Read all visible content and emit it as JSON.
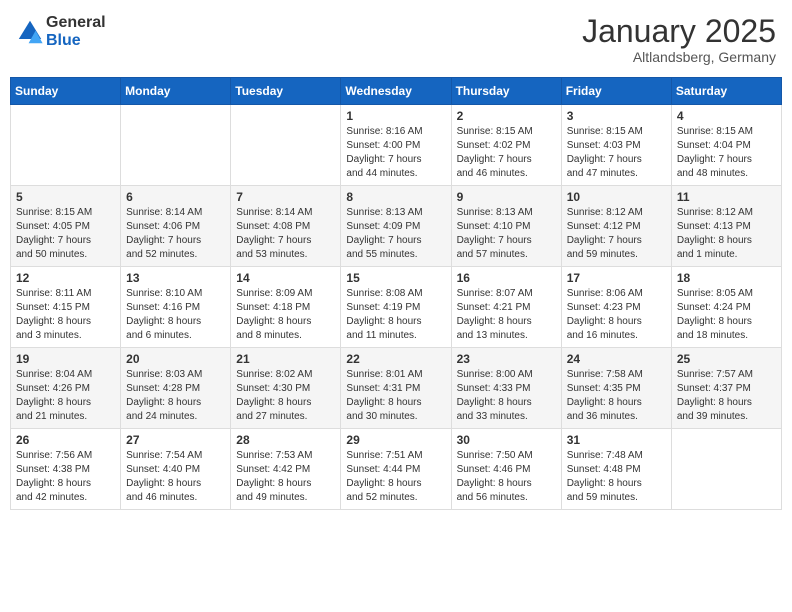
{
  "logo": {
    "general": "General",
    "blue": "Blue"
  },
  "header": {
    "month": "January 2025",
    "location": "Altlandsberg, Germany"
  },
  "weekdays": [
    "Sunday",
    "Monday",
    "Tuesday",
    "Wednesday",
    "Thursday",
    "Friday",
    "Saturday"
  ],
  "weeks": [
    [
      {
        "day": "",
        "info": ""
      },
      {
        "day": "",
        "info": ""
      },
      {
        "day": "",
        "info": ""
      },
      {
        "day": "1",
        "info": "Sunrise: 8:16 AM\nSunset: 4:00 PM\nDaylight: 7 hours\nand 44 minutes."
      },
      {
        "day": "2",
        "info": "Sunrise: 8:15 AM\nSunset: 4:02 PM\nDaylight: 7 hours\nand 46 minutes."
      },
      {
        "day": "3",
        "info": "Sunrise: 8:15 AM\nSunset: 4:03 PM\nDaylight: 7 hours\nand 47 minutes."
      },
      {
        "day": "4",
        "info": "Sunrise: 8:15 AM\nSunset: 4:04 PM\nDaylight: 7 hours\nand 48 minutes."
      }
    ],
    [
      {
        "day": "5",
        "info": "Sunrise: 8:15 AM\nSunset: 4:05 PM\nDaylight: 7 hours\nand 50 minutes."
      },
      {
        "day": "6",
        "info": "Sunrise: 8:14 AM\nSunset: 4:06 PM\nDaylight: 7 hours\nand 52 minutes."
      },
      {
        "day": "7",
        "info": "Sunrise: 8:14 AM\nSunset: 4:08 PM\nDaylight: 7 hours\nand 53 minutes."
      },
      {
        "day": "8",
        "info": "Sunrise: 8:13 AM\nSunset: 4:09 PM\nDaylight: 7 hours\nand 55 minutes."
      },
      {
        "day": "9",
        "info": "Sunrise: 8:13 AM\nSunset: 4:10 PM\nDaylight: 7 hours\nand 57 minutes."
      },
      {
        "day": "10",
        "info": "Sunrise: 8:12 AM\nSunset: 4:12 PM\nDaylight: 7 hours\nand 59 minutes."
      },
      {
        "day": "11",
        "info": "Sunrise: 8:12 AM\nSunset: 4:13 PM\nDaylight: 8 hours\nand 1 minute."
      }
    ],
    [
      {
        "day": "12",
        "info": "Sunrise: 8:11 AM\nSunset: 4:15 PM\nDaylight: 8 hours\nand 3 minutes."
      },
      {
        "day": "13",
        "info": "Sunrise: 8:10 AM\nSunset: 4:16 PM\nDaylight: 8 hours\nand 6 minutes."
      },
      {
        "day": "14",
        "info": "Sunrise: 8:09 AM\nSunset: 4:18 PM\nDaylight: 8 hours\nand 8 minutes."
      },
      {
        "day": "15",
        "info": "Sunrise: 8:08 AM\nSunset: 4:19 PM\nDaylight: 8 hours\nand 11 minutes."
      },
      {
        "day": "16",
        "info": "Sunrise: 8:07 AM\nSunset: 4:21 PM\nDaylight: 8 hours\nand 13 minutes."
      },
      {
        "day": "17",
        "info": "Sunrise: 8:06 AM\nSunset: 4:23 PM\nDaylight: 8 hours\nand 16 minutes."
      },
      {
        "day": "18",
        "info": "Sunrise: 8:05 AM\nSunset: 4:24 PM\nDaylight: 8 hours\nand 18 minutes."
      }
    ],
    [
      {
        "day": "19",
        "info": "Sunrise: 8:04 AM\nSunset: 4:26 PM\nDaylight: 8 hours\nand 21 minutes."
      },
      {
        "day": "20",
        "info": "Sunrise: 8:03 AM\nSunset: 4:28 PM\nDaylight: 8 hours\nand 24 minutes."
      },
      {
        "day": "21",
        "info": "Sunrise: 8:02 AM\nSunset: 4:30 PM\nDaylight: 8 hours\nand 27 minutes."
      },
      {
        "day": "22",
        "info": "Sunrise: 8:01 AM\nSunset: 4:31 PM\nDaylight: 8 hours\nand 30 minutes."
      },
      {
        "day": "23",
        "info": "Sunrise: 8:00 AM\nSunset: 4:33 PM\nDaylight: 8 hours\nand 33 minutes."
      },
      {
        "day": "24",
        "info": "Sunrise: 7:58 AM\nSunset: 4:35 PM\nDaylight: 8 hours\nand 36 minutes."
      },
      {
        "day": "25",
        "info": "Sunrise: 7:57 AM\nSunset: 4:37 PM\nDaylight: 8 hours\nand 39 minutes."
      }
    ],
    [
      {
        "day": "26",
        "info": "Sunrise: 7:56 AM\nSunset: 4:38 PM\nDaylight: 8 hours\nand 42 minutes."
      },
      {
        "day": "27",
        "info": "Sunrise: 7:54 AM\nSunset: 4:40 PM\nDaylight: 8 hours\nand 46 minutes."
      },
      {
        "day": "28",
        "info": "Sunrise: 7:53 AM\nSunset: 4:42 PM\nDaylight: 8 hours\nand 49 minutes."
      },
      {
        "day": "29",
        "info": "Sunrise: 7:51 AM\nSunset: 4:44 PM\nDaylight: 8 hours\nand 52 minutes."
      },
      {
        "day": "30",
        "info": "Sunrise: 7:50 AM\nSunset: 4:46 PM\nDaylight: 8 hours\nand 56 minutes."
      },
      {
        "day": "31",
        "info": "Sunrise: 7:48 AM\nSunset: 4:48 PM\nDaylight: 8 hours\nand 59 minutes."
      },
      {
        "day": "",
        "info": ""
      }
    ]
  ]
}
